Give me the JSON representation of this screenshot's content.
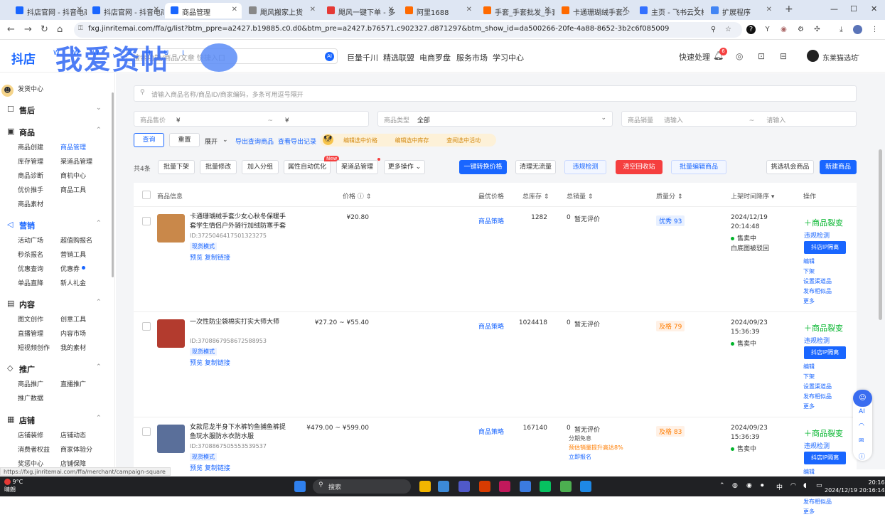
{
  "browser": {
    "tabs": [
      {
        "label": "抖店官网 - 抖音电商",
        "active": false,
        "color": "#1966ff"
      },
      {
        "label": "抖店官网 - 抖音电商",
        "active": false,
        "color": "#1966ff"
      },
      {
        "label": "商品管理",
        "active": true,
        "color": "#1966ff"
      },
      {
        "label": "飓风搬家上货",
        "active": false,
        "color": "#888"
      },
      {
        "label": "飓风一键下单 - 多",
        "active": false,
        "color": "#e53935"
      },
      {
        "label": "阿里1688",
        "active": false,
        "color": "#ff6a00"
      },
      {
        "label": "手套_手套批发_手套",
        "active": false,
        "color": "#ff6a00"
      },
      {
        "label": "卡通珊瑚绒手套少",
        "active": false,
        "color": "#ff6a00"
      },
      {
        "label": "主页 - 飞书云文档",
        "active": false,
        "color": "#3370ff"
      },
      {
        "label": "扩展程序",
        "active": false,
        "color": "#4285f4"
      }
    ],
    "new_tab": "+",
    "url": "fxg.jinritemai.com/ffa/g/list?btm_ppre=a2427.b19885.c0.d0&btm_pre=a2427.b76571.c902327.d871297&btm_show_id=da500266-20fe-4a88-8652-3b2c6f085009"
  },
  "topbar": {
    "logo": "抖店",
    "watermark": "我爱资帖",
    "watermark_sub": "W W W . Z H U I",
    "search_placeholder": "搜索功能/商品/文章 快捷入口",
    "ai_label": "AI",
    "nav": [
      "巨量千川",
      "精选联盟",
      "电商罗盘",
      "服务市场",
      "学习中心"
    ],
    "quick": "快速处理",
    "bell_count": "6",
    "user": "东莱猫选坊"
  },
  "sidebar": {
    "top_link": "发货中心",
    "groups": [
      {
        "title": "售后",
        "icon": "☐",
        "items": []
      },
      {
        "title": "商品",
        "icon": "▣",
        "items": [
          "商品创建",
          "商品管理",
          "库存管理",
          "渠道品管理",
          "商品诊断",
          "商机中心",
          "优价推手",
          "商品工具",
          "商品素材"
        ]
      },
      {
        "title": "营销",
        "icon": "◁",
        "items": [
          "活动广场",
          "超值购报名",
          "秒杀报名",
          "营销工具",
          "优惠查询",
          "优惠券",
          "单品直降",
          "新人礼金"
        ]
      },
      {
        "title": "内容",
        "icon": "▤",
        "items": [
          "图文创作",
          "创意工具",
          "直播管理",
          "内容市场",
          "短视频创作",
          "我的素材"
        ]
      },
      {
        "title": "推广",
        "icon": "◇",
        "items": [
          "商品推广",
          "直播推广",
          "推广数据"
        ]
      },
      {
        "title": "店铺",
        "icon": "▦",
        "items": [
          "店铺装修",
          "店铺动态",
          "消费者权益",
          "商家体验分",
          "奖惩中心",
          "店铺保障"
        ]
      }
    ]
  },
  "filters": {
    "search_placeholder": "请输入商品名称/商品ID/商家编码，多条可用逗号隔开",
    "price_label": "商品售价",
    "price_from": "¥",
    "price_sep": "~",
    "price_to": "¥",
    "type_label": "商品类型",
    "type_value": "全部",
    "sales_label": "商品销量",
    "sales_from": "请输入",
    "sales_sep": "~",
    "sales_to": "请输入",
    "query_btn": "查询",
    "reset_btn": "重置",
    "expand": "展开",
    "export": "导出查询商品",
    "export_log": "查看导出记录",
    "promo": [
      "编辑选中价格",
      "编辑选中库存",
      "查阅选中活动"
    ]
  },
  "toolbar": {
    "count": "共4条",
    "buttons": [
      "批量下架",
      "批量修改",
      "加入分组",
      "属性自动优化",
      "渠道品管理",
      "更多操作"
    ],
    "new_badge": "New",
    "right_buttons": [
      "一键转换价格",
      "清理无流量",
      "违规检测",
      "清空回收站",
      "批量编辑商品"
    ],
    "pick": "挑选机会商品",
    "create": "新建商品"
  },
  "table": {
    "headers": [
      "商品信息",
      "价格",
      "最优价格",
      "总库存",
      "总销量",
      "质量分",
      "上架时间降序",
      "操作"
    ],
    "rows": [
      {
        "title": "卡通珊瑚绒手套少女心秋冬保暖手套学生情侣户外骑行加绒防寒手套",
        "id": "ID:3725046417501323275",
        "tag": "现货模式",
        "links": "预览 复制链接",
        "price": "¥20.80",
        "best": "商品策略",
        "stock": "1282",
        "sales": "0",
        "sales_note": "暂无评价",
        "quality": "优秀 93",
        "quality_level": "good",
        "date": "2024/12/19",
        "time": "20:14:48",
        "status": "售卖中",
        "audit": "白底图被驳回",
        "img_color": "#c9884a"
      },
      {
        "title": "一次性防尘袋棉实打实大师大师",
        "id": "ID:3708867958672588953",
        "tag": "现货模式",
        "links": "预览 复制链接",
        "price": "¥27.20 ~ ¥55.40",
        "best": "商品策略",
        "stock": "1024418",
        "sales": "0",
        "sales_note": "暂无评价",
        "quality": "及格 79",
        "quality_level": "ok",
        "date": "2024/09/23",
        "time": "15:36:39",
        "status": "售卖中",
        "audit": "",
        "img_color": "#b33b2e"
      },
      {
        "title": "女款尼龙半身下水裤钓鱼捕鱼裤捉鱼玩水服防水衣防水服",
        "id": "ID:3708867505553539537",
        "tag": "现货模式",
        "links": "预览 复制链接",
        "price": "¥479.00 ~ ¥599.00",
        "best": "商品策略",
        "stock": "167140",
        "sales": "0",
        "sales_note": "暂无评价",
        "quality": "及格 83",
        "quality_level": "ok",
        "date": "2024/09/23",
        "time": "15:36:39",
        "status": "售卖中",
        "audit": "",
        "img_color": "#5a6f9a",
        "extra": [
          "分期免息",
          "预估销量提升高达8%",
          "立即报名"
        ]
      }
    ],
    "ops": {
      "split": "＋商品裂变",
      "check": "违规检测",
      "ip": "抖店IP隔离",
      "list": [
        "编辑",
        "下架",
        "设置渠道品",
        "发布相似品",
        "更多"
      ]
    }
  },
  "status_url": "https://fxg.jinritemai.com/ffa/merchant/campaign-square",
  "taskbar": {
    "weather_temp": "9°C",
    "weather_desc": "晴朗",
    "search": "搜索",
    "time": "20:16",
    "date": "2024/12/19 20:16:14",
    "lang": "中"
  }
}
